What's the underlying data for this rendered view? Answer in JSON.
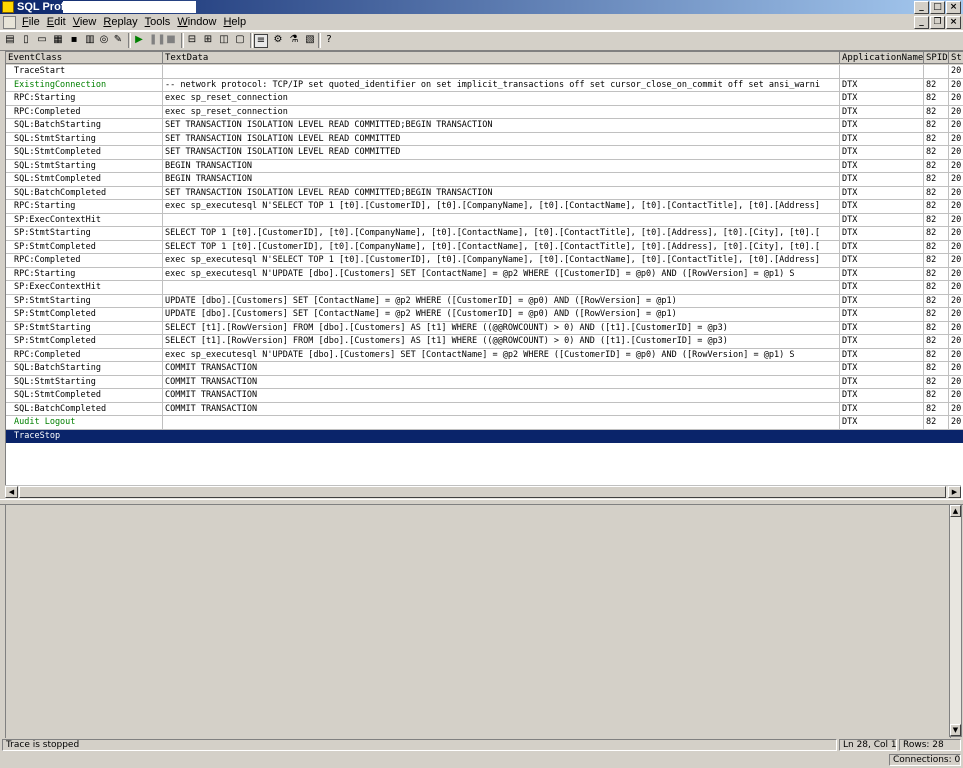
{
  "window": {
    "title": "SQL Profiler"
  },
  "menu": [
    {
      "key": "F",
      "rest": "ile"
    },
    {
      "key": "E",
      "rest": "dit"
    },
    {
      "key": "V",
      "rest": "iew"
    },
    {
      "key": "R",
      "rest": "eplay"
    },
    {
      "key": "T",
      "rest": "ools"
    },
    {
      "key": "W",
      "rest": "indow"
    },
    {
      "key": "H",
      "rest": "elp"
    }
  ],
  "columns": [
    "EventClass",
    "TextData",
    "ApplicationName",
    "SPID",
    "St"
  ],
  "rows": [
    {
      "ev": "TraceStart",
      "td": "",
      "app": "",
      "spid": "",
      "st": "20",
      "color": "#000000"
    },
    {
      "ev": "ExistingConnection",
      "td": "-- network protocol: TCP/IP set quoted_identifier on set implicit_transactions off set cursor_close_on_commit off set ansi_warni",
      "app": "DTX",
      "spid": "82",
      "st": "20",
      "color": "#008000"
    },
    {
      "ev": "RPC:Starting",
      "td": "exec sp_reset_connection",
      "app": "DTX",
      "spid": "82",
      "st": "20",
      "color": "#000000"
    },
    {
      "ev": "RPC:Completed",
      "td": "exec sp_reset_connection",
      "app": "DTX",
      "spid": "82",
      "st": "20",
      "color": "#000000"
    },
    {
      "ev": "SQL:BatchStarting",
      "td": "SET TRANSACTION ISOLATION LEVEL READ COMMITTED;BEGIN TRANSACTION",
      "app": "DTX",
      "spid": "82",
      "st": "20",
      "color": "#000000"
    },
    {
      "ev": "SQL:StmtStarting",
      "td": "SET TRANSACTION ISOLATION LEVEL READ COMMITTED",
      "app": "DTX",
      "spid": "82",
      "st": "20",
      "color": "#000000"
    },
    {
      "ev": "SQL:StmtCompleted",
      "td": "SET TRANSACTION ISOLATION LEVEL READ COMMITTED",
      "app": "DTX",
      "spid": "82",
      "st": "20",
      "color": "#000000"
    },
    {
      "ev": "SQL:StmtStarting",
      "td": "BEGIN TRANSACTION",
      "app": "DTX",
      "spid": "82",
      "st": "20",
      "color": "#000000"
    },
    {
      "ev": "SQL:StmtCompleted",
      "td": "BEGIN TRANSACTION",
      "app": "DTX",
      "spid": "82",
      "st": "20",
      "color": "#000000"
    },
    {
      "ev": "SQL:BatchCompleted",
      "td": "SET TRANSACTION ISOLATION LEVEL READ COMMITTED;BEGIN TRANSACTION",
      "app": "DTX",
      "spid": "82",
      "st": "20",
      "color": "#000000"
    },
    {
      "ev": "RPC:Starting",
      "td": "exec sp_executesql N'SELECT TOP 1 [t0].[CustomerID], [t0].[CompanyName], [t0].[ContactName], [t0].[ContactTitle], [t0].[Address]",
      "app": "DTX",
      "spid": "82",
      "st": "20",
      "color": "#000000"
    },
    {
      "ev": "SP:ExecContextHit",
      "td": "",
      "app": "DTX",
      "spid": "82",
      "st": "20",
      "color": "#000000"
    },
    {
      "ev": "SP:StmtStarting",
      "td": "SELECT TOP 1 [t0].[CustomerID], [t0].[CompanyName], [t0].[ContactName], [t0].[ContactTitle], [t0].[Address], [t0].[City], [t0].[",
      "app": "DTX",
      "spid": "82",
      "st": "20",
      "color": "#000000"
    },
    {
      "ev": "SP:StmtCompleted",
      "td": "SELECT TOP 1 [t0].[CustomerID], [t0].[CompanyName], [t0].[ContactName], [t0].[ContactTitle], [t0].[Address], [t0].[City], [t0].[",
      "app": "DTX",
      "spid": "82",
      "st": "20",
      "color": "#000000"
    },
    {
      "ev": "RPC:Completed",
      "td": "exec sp_executesql N'SELECT TOP 1 [t0].[CustomerID], [t0].[CompanyName], [t0].[ContactName], [t0].[ContactTitle], [t0].[Address]",
      "app": "DTX",
      "spid": "82",
      "st": "20",
      "color": "#000000"
    },
    {
      "ev": "RPC:Starting",
      "td": "exec sp_executesql N'UPDATE [dbo].[Customers]  SET [ContactName] = @p2  WHERE ([CustomerID] = @p0) AND ([RowVersion] = @p1)    S",
      "app": "DTX",
      "spid": "82",
      "st": "20",
      "color": "#000000"
    },
    {
      "ev": "SP:ExecContextHit",
      "td": "",
      "app": "DTX",
      "spid": "82",
      "st": "20",
      "color": "#000000"
    },
    {
      "ev": "SP:StmtStarting",
      "td": "UPDATE [dbo].[Customers]  SET [ContactName] = @p2  WHERE ([CustomerID] = @p0) AND ([RowVersion] = @p1)",
      "app": "DTX",
      "spid": "82",
      "st": "20",
      "color": "#000000"
    },
    {
      "ev": "SP:StmtCompleted",
      "td": "UPDATE [dbo].[Customers]  SET [ContactName] = @p2  WHERE ([CustomerID] = @p0) AND ([RowVersion] = @p1)",
      "app": "DTX",
      "spid": "82",
      "st": "20",
      "color": "#000000"
    },
    {
      "ev": "SP:StmtStarting",
      "td": "SELECT [t1].[RowVersion]  FROM [dbo].[Customers] AS [t1]  WHERE ((@@ROWCOUNT) > 0) AND ([t1].[CustomerID] = @p3)",
      "app": "DTX",
      "spid": "82",
      "st": "20",
      "color": "#000000"
    },
    {
      "ev": "SP:StmtCompleted",
      "td": "SELECT [t1].[RowVersion]  FROM [dbo].[Customers] AS [t1]  WHERE ((@@ROWCOUNT) > 0) AND ([t1].[CustomerID] = @p3)",
      "app": "DTX",
      "spid": "82",
      "st": "20",
      "color": "#000000"
    },
    {
      "ev": "RPC:Completed",
      "td": "exec sp_executesql N'UPDATE [dbo].[Customers]  SET [ContactName] = @p2  WHERE ([CustomerID] = @p0) AND ([RowVersion] = @p1)    S",
      "app": "DTX",
      "spid": "82",
      "st": "20",
      "color": "#000000"
    },
    {
      "ev": "SQL:BatchStarting",
      "td": "COMMIT TRANSACTION",
      "app": "DTX",
      "spid": "82",
      "st": "20",
      "color": "#000000"
    },
    {
      "ev": "SQL:StmtStarting",
      "td": "COMMIT TRANSACTION",
      "app": "DTX",
      "spid": "82",
      "st": "20",
      "color": "#000000"
    },
    {
      "ev": "SQL:StmtCompleted",
      "td": "COMMIT TRANSACTION",
      "app": "DTX",
      "spid": "82",
      "st": "20",
      "color": "#000000"
    },
    {
      "ev": "SQL:BatchCompleted",
      "td": "COMMIT TRANSACTION",
      "app": "DTX",
      "spid": "82",
      "st": "20",
      "color": "#000000"
    },
    {
      "ev": "Audit Logout",
      "td": "",
      "app": "DTX",
      "spid": "82",
      "st": "20",
      "color": "#008000"
    },
    {
      "ev": "TraceStop",
      "td": "",
      "app": "",
      "spid": "",
      "st": "",
      "color": "#ffffff",
      "selected": true
    }
  ],
  "status": {
    "message": "Trace is stopped",
    "position": "Ln 28, Col 1",
    "rows": "Rows: 28",
    "connections": "Connections: 0"
  },
  "colors": {
    "title_start": "#0a246a",
    "selection": "#0a246a",
    "green_event": "#008000",
    "chrome": "#d4d0c8"
  }
}
